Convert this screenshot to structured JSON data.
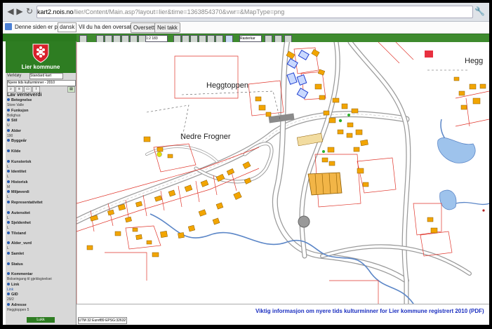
{
  "browser": {
    "url_domain": "kart2.nois.no",
    "url_path": "/lier/Content/Main.asp?layout=lier&time=1363854370&vwr=&MapType=png"
  },
  "translate": {
    "prompt": "Denne siden er på",
    "language": "dansk",
    "question": "Vil du ha den oversatt?",
    "translate_button": "Oversett",
    "no_button": "Nei takk"
  },
  "sidebar": {
    "kommune_name": "Lier kommune",
    "verktoy_label": "Verktøy",
    "basemap": "Standard kart",
    "theme": "Nyere tids kulturminner - 2010",
    "section_title": "Lav verneverdi",
    "fields": [
      {
        "label": "Betegnelse",
        "value": "Store Valle"
      },
      {
        "label": "Funksjon",
        "value": "Bolighus"
      },
      {
        "label": "Stil",
        "value": "U"
      },
      {
        "label": "Alder",
        "value": "190"
      },
      {
        "label": "Byggeår",
        "value": ""
      },
      {
        "label": "Kilde",
        "value": ""
      },
      {
        "label": "Kunsterisk",
        "value": "L"
      },
      {
        "label": "Identitet",
        "value": "L"
      },
      {
        "label": "Historisk",
        "value": "M"
      },
      {
        "label": "Miljøverdi",
        "value": "L"
      },
      {
        "label": "Representativitet",
        "value": ""
      },
      {
        "label": "Autensitet",
        "value": "L"
      },
      {
        "label": "Sjeldenhet",
        "value": "L"
      },
      {
        "label": "Tilstand",
        "value": ""
      },
      {
        "label": "Alder_vurd",
        "value": "L"
      },
      {
        "label": "Samlet",
        "value": ""
      },
      {
        "label": "Status",
        "value": ""
      },
      {
        "label": "Kommentar",
        "value": "Bolseingang til gjeldsgivelsei"
      },
      {
        "label": "Link",
        "value": "Link"
      },
      {
        "label": "GID",
        "value": "29/2"
      },
      {
        "label": "Adresse",
        "value": "Heggtoppen 5"
      }
    ],
    "close_button": "Lukk"
  },
  "map_toolbar": {
    "scale": "1:2 183",
    "layer": "Rasterkar"
  },
  "map": {
    "place_names": {
      "heggtoppen": "Heggtoppen",
      "nedre_frogner": "Nedre Frogner",
      "hegg": "Hegg"
    }
  },
  "footer": {
    "coordinates": "UTM 32 Euref89 EPSG:32632",
    "info_link": "Viktig informasjon om nyere tids kulturminner for Lier kommune registrert 2010 (PDF)"
  },
  "colors": {
    "accent_green": "#2e7d22",
    "link_blue": "#1a2ec0",
    "building_orange": "#f2a500",
    "property_red": "#e0352b"
  }
}
